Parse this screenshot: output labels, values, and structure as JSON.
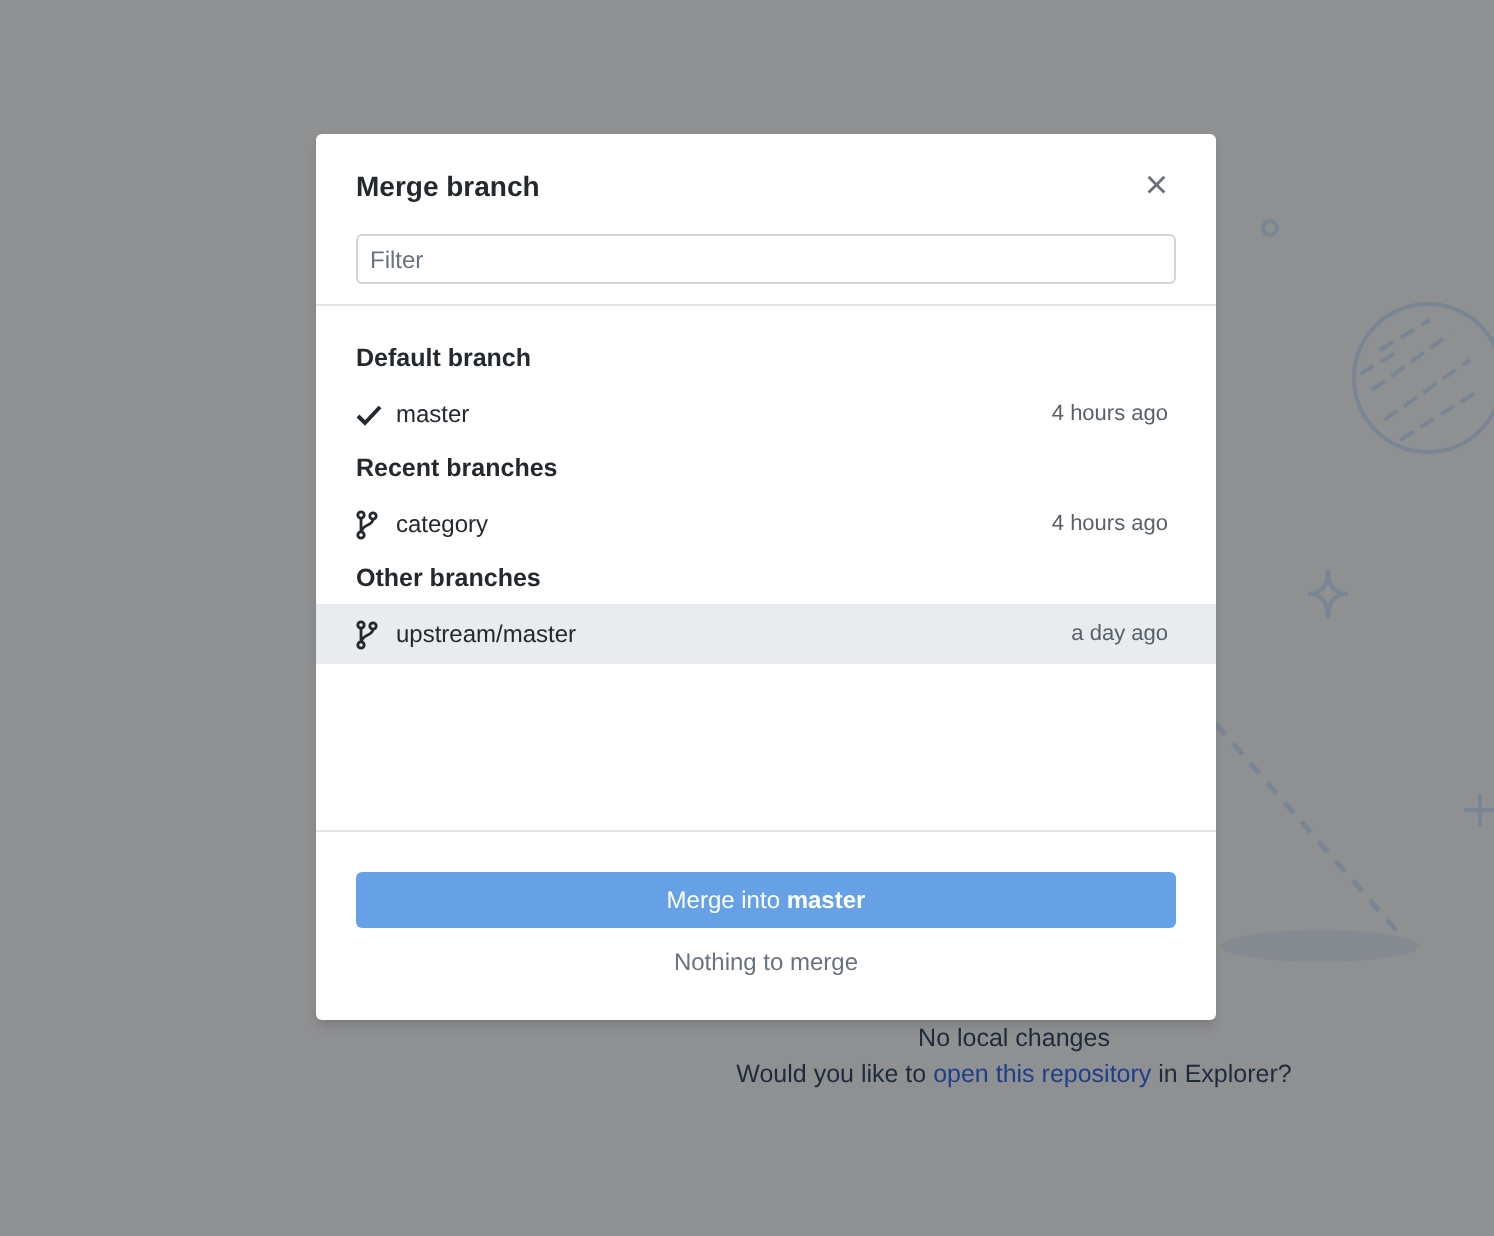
{
  "background": {
    "message": "No local changes",
    "prompt": {
      "before": "Would you like to ",
      "link": "open this repository",
      "after": " in Explorer?"
    }
  },
  "dialog": {
    "title": "Merge branch",
    "close": "×",
    "filter": {
      "placeholder": "Filter"
    },
    "groups": [
      {
        "header": "Default branch",
        "branches": [
          {
            "kind": "check",
            "name": "master",
            "time": "4 hours ago",
            "selected": false
          }
        ]
      },
      {
        "header": "Recent branches",
        "branches": [
          {
            "kind": "branch",
            "name": "category",
            "time": "4 hours ago",
            "selected": false
          }
        ]
      },
      {
        "header": "Other branches",
        "branches": [
          {
            "kind": "branch",
            "name": "upstream/master",
            "time": "a day ago",
            "selected": true
          }
        ]
      }
    ],
    "button": {
      "label": "Merge into **master**",
      "disabled": true
    },
    "status": "Nothing to merge"
  }
}
